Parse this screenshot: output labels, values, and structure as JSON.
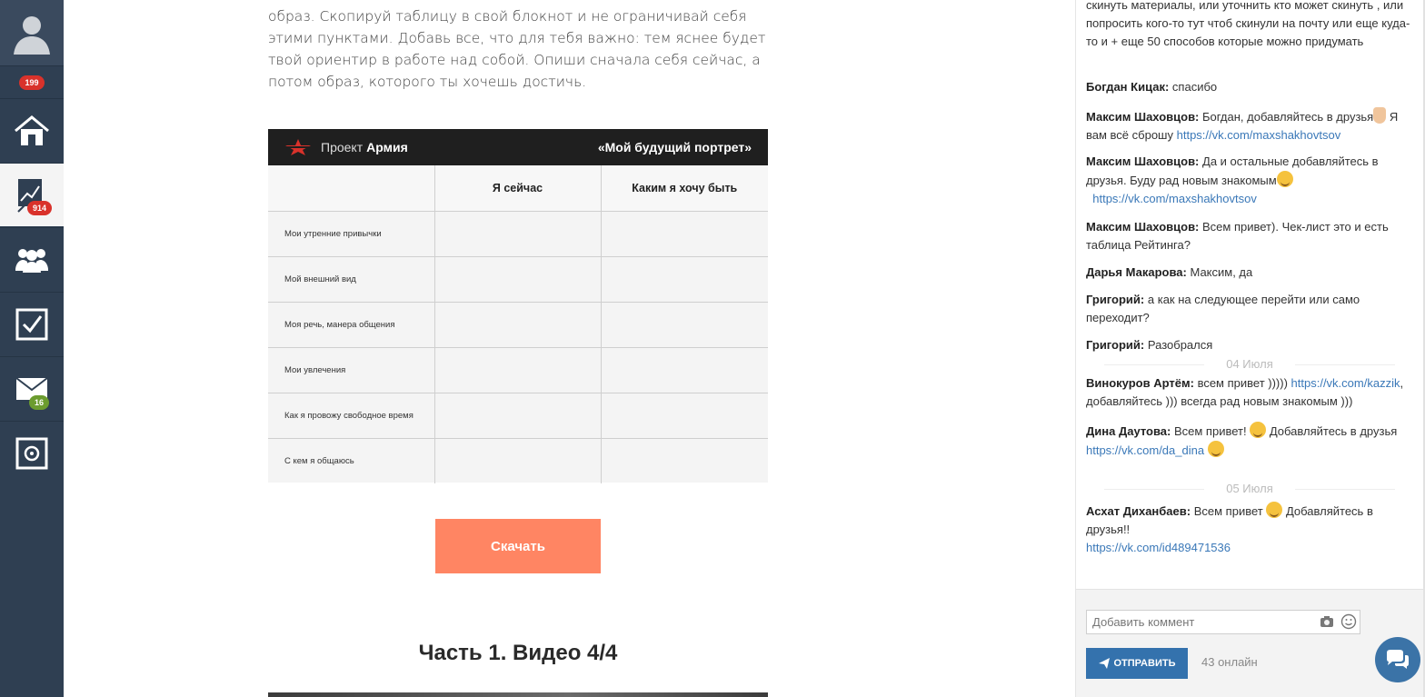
{
  "sidebar": {
    "notifications_badge": "199",
    "stats_badge": "914",
    "mail_badge": "16"
  },
  "main": {
    "intro_text": "образ. Скопируй таблицу в свой блокнот и не ограничивай себя этими пунктами. Добавь все, что для тебя важно: тем яснее будет твой ориентир в работе над собой. Опиши сначала себя сейчас, а потом образ, которого ты хочешь достичь.",
    "portrait": {
      "brand_prefix": "Проект",
      "brand_name": "Армия",
      "title": "«Мой будущий портрет»",
      "columns": [
        "",
        "Я сейчас",
        "Каким я хочу быть"
      ],
      "rows": [
        "Мои утренние привычки",
        "Мой внешний вид",
        "Моя речь, манера общения",
        "Мои увлечения",
        "Как я провожу свободное время",
        "С кем я общаюсь"
      ]
    },
    "download_label": "Скачать",
    "part_title": "Часть 1. Видео 4/4"
  },
  "chat": {
    "messages": [
      {
        "author": "",
        "text": "скинуть материалы, или уточнить кто может скинуть , или попросить кого-то тут чтоб скинули на почту или еще куда-то и + еще 50 способов которые можно придумать"
      },
      {
        "author": "Богдан Кицак:",
        "text": "спасибо"
      },
      {
        "author": "Максим Шаховцов:",
        "text": "Богдан, добавляйтесь в друзья",
        "text2": "Я вам всё сброшу",
        "link": "https://vk.com/maxshakhovtsov"
      },
      {
        "author": "Максим Шаховцов:",
        "text": "Да и остальные добавляйтесь в друзья. Буду рад новым знакомым",
        "link": "https://vk.com/maxshakhovtsov"
      },
      {
        "author": "Максим Шаховцов:",
        "text": "Всем привет). Чек-лист это и есть таблица Рейтинга?"
      },
      {
        "author": "Дарья Макарова:",
        "text": "Максим, да"
      },
      {
        "author": "Григорий:",
        "text": "а как на следующее перейти или само переходит?"
      },
      {
        "author": "Григорий:",
        "text": "Разобрался"
      },
      {
        "author": "Винокуров Артём:",
        "text": "всем привет )))))",
        "link": "https://vk.com/kazzik",
        "text2": ", добавляйтесь ))) всегда рад новым знакомым )))"
      },
      {
        "author": "Дина Даутова:",
        "text": "Всем привет!",
        "text2": "Добавляйтесь в друзья",
        "link": "https://vk.com/da_dina"
      },
      {
        "author": "Асхат Диханбаев:",
        "text": "Всем привет",
        "text2": "Добавляйтесь в друзья!!",
        "link": "https://vk.com/id489471536"
      }
    ],
    "dates": [
      "04 Июля",
      "05 Июля"
    ],
    "input_placeholder": "Добавить коммент",
    "send_label": "ОТПРАВИТЬ",
    "online_text": "43 онлайн"
  },
  "colors": {
    "sidebar_bg": "#2f3f52",
    "accent_orange": "#ff8563",
    "send_blue": "#3472ad",
    "badge_red": "#d9322b",
    "badge_green": "#6c9c2f"
  }
}
